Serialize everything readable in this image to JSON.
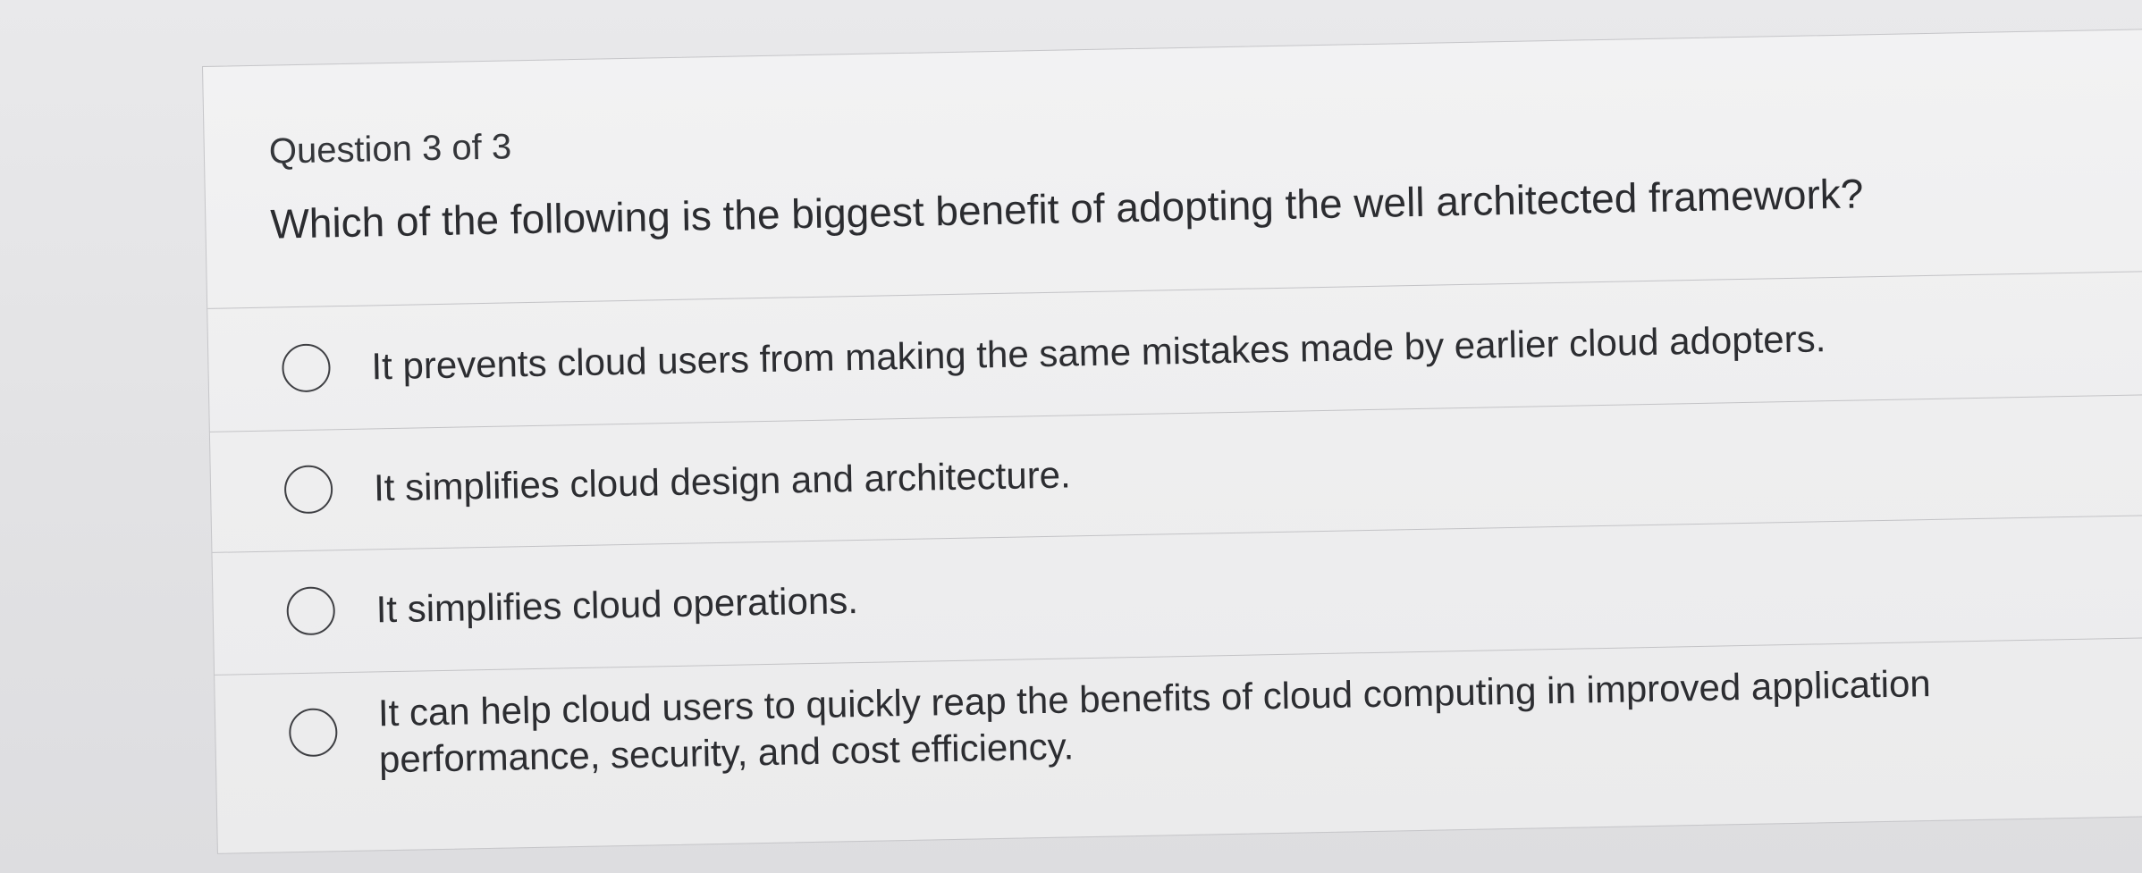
{
  "quiz": {
    "counter": "Question 3 of 3",
    "question": "Which of the following is the biggest benefit of adopting the well architected framework?",
    "options": [
      {
        "label": "It prevents cloud users from making the same mistakes made by earlier cloud adopters.",
        "selected": false
      },
      {
        "label": "It simplifies cloud design and architecture.",
        "selected": false
      },
      {
        "label": "It simplifies cloud operations.",
        "selected": false
      },
      {
        "label": "It can help cloud users to quickly reap the benefits of cloud computing in improved application",
        "label_line2": "performance, security, and cost efficiency.",
        "selected": false
      }
    ]
  },
  "icons": {
    "option_marker": "radio-button-icon"
  },
  "colors": {
    "page_background": "#e4e4e6",
    "card_background": "#eeeeef",
    "text": "#2e2f33",
    "divider": "#c3c3c6"
  }
}
